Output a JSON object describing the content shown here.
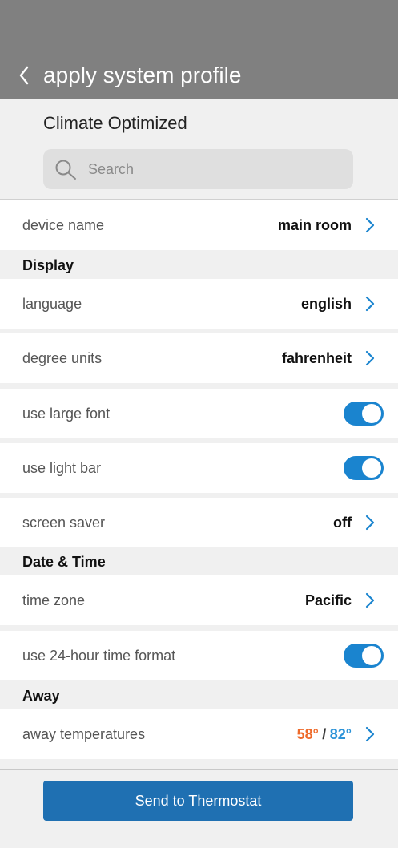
{
  "header": {
    "title": "apply system profile"
  },
  "profile": {
    "name": "Climate Optimized"
  },
  "search": {
    "placeholder": "Search"
  },
  "rows": {
    "device_name": {
      "label": "device name",
      "value": "main room"
    },
    "display_section": "Display",
    "language": {
      "label": "language",
      "value": "english"
    },
    "degree_units": {
      "label": "degree units",
      "value": "fahrenheit"
    },
    "large_font": {
      "label": "use large font",
      "on": true
    },
    "light_bar": {
      "label": "use light bar",
      "on": true
    },
    "screen_saver": {
      "label": "screen saver",
      "value": "off"
    },
    "date_time_section": "Date & Time",
    "time_zone": {
      "label": "time zone",
      "value": "Pacific"
    },
    "time_format": {
      "label": "use 24-hour time format",
      "on": true
    },
    "away_section": "Away",
    "away_temps": {
      "label": "away temperatures",
      "heat": "58°",
      "separator": "/",
      "cool": "82°"
    }
  },
  "footer": {
    "send_label": "Send to Thermostat"
  },
  "colors": {
    "header_bg": "#808080",
    "accent": "#1a84cf",
    "heat": "#ee6a2a",
    "cool": "#2c93d8",
    "button": "#1f70b2"
  }
}
